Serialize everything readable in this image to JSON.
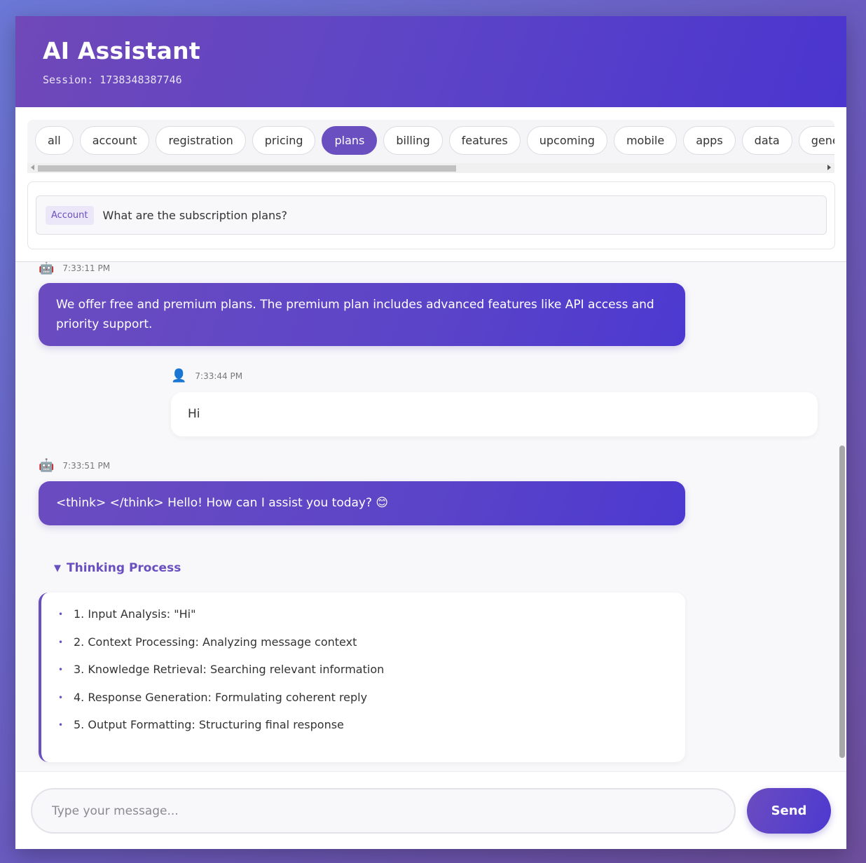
{
  "header": {
    "title": "AI Assistant",
    "session": "Session: 1738348387746"
  },
  "tags": [
    "all",
    "account",
    "registration",
    "pricing",
    "plans",
    "billing",
    "features",
    "upcoming",
    "mobile",
    "apps",
    "data",
    "genera"
  ],
  "active_tag": "plans",
  "question": {
    "badge": "Account",
    "text": "What are the subscription plans?"
  },
  "messages": [
    {
      "role": "bot",
      "icon": "robot-icon",
      "time": "7:33:11 PM",
      "text": "We offer free and premium plans. The premium plan includes advanced features like API access and priority support."
    },
    {
      "role": "user",
      "icon": "user-icon",
      "time": "7:33:44 PM",
      "text": "Hi"
    },
    {
      "role": "bot",
      "icon": "robot-icon",
      "time": "7:33:51 PM",
      "text": "<think> </think> Hello! How can I assist you today? 😊"
    }
  ],
  "thinking": {
    "toggle_label": "Thinking Process",
    "steps": [
      "1. Input Analysis: \"Hi\"",
      "2. Context Processing: Analyzing message context",
      "3. Knowledge Retrieval: Searching relevant information",
      "4. Response Generation: Formulating coherent reply",
      "5. Output Formatting: Structuring final response"
    ]
  },
  "input": {
    "placeholder": "Type your message...",
    "value": ""
  },
  "send_label": "Send",
  "colors": {
    "accent": "#6a4fc0",
    "header_gradient_start": "#7048b8",
    "header_gradient_end": "#4a35cf"
  }
}
